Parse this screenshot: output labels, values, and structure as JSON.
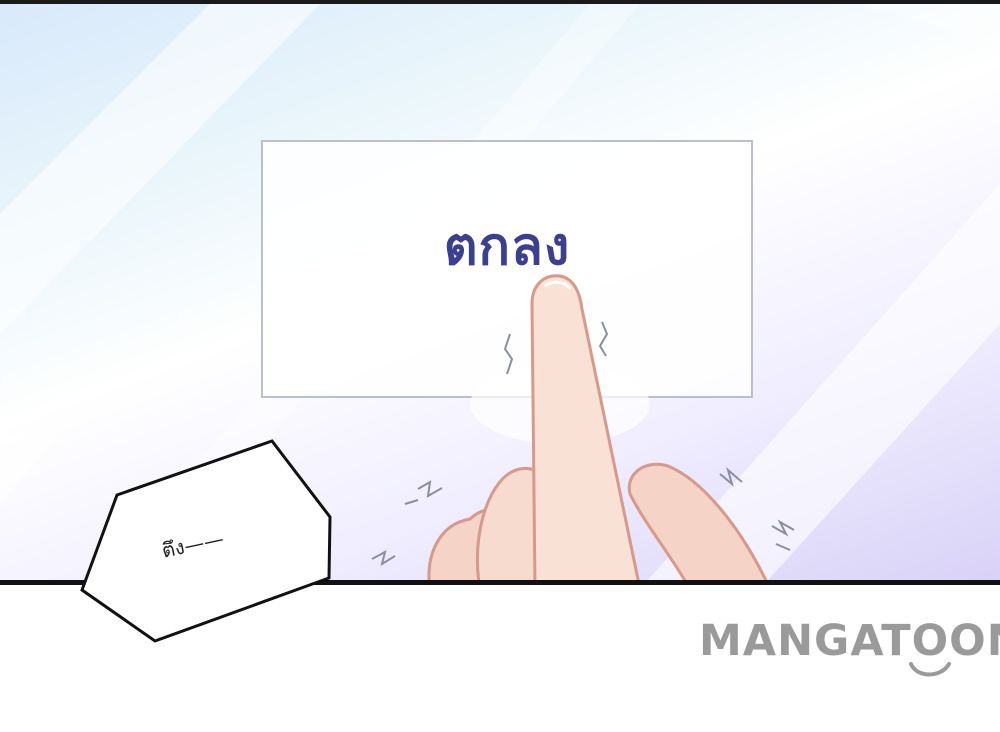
{
  "scene": {
    "button_text": "ตกลง",
    "sound_effect": "ตึง——"
  },
  "watermark": {
    "brand": "MANGATOON"
  },
  "colors": {
    "button_text": "#3b3f8f",
    "panel_border": "#111111",
    "watermark": "#9a9a9a",
    "skin": "#f5d3c6",
    "skin_outline": "#d79a8a"
  }
}
